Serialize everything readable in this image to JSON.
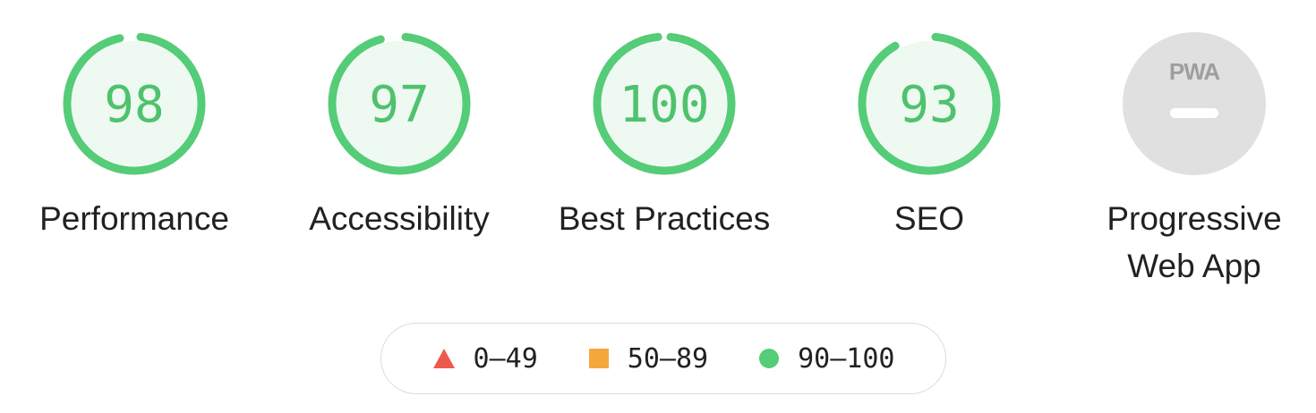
{
  "colors": {
    "pass": "#55cc77",
    "pass_fill": "#eef9f1",
    "pass_text": "#4fc26d",
    "average": "#f4a83c",
    "fail": "#ec5a4b",
    "na_fill": "#e0e0e0",
    "na_mark": "#9e9e9e",
    "text": "#212121"
  },
  "categories": [
    {
      "id": "performance",
      "score": 98,
      "label": "Performance"
    },
    {
      "id": "accessibility",
      "score": 97,
      "label": "Accessibility"
    },
    {
      "id": "best-practices",
      "score": 100,
      "label": "Best Practices"
    },
    {
      "id": "seo",
      "score": 93,
      "label": "SEO"
    }
  ],
  "pwa": {
    "badge_text": "PWA",
    "label_line1": "Progressive",
    "label_line2": "Web App"
  },
  "legend": [
    {
      "shape": "triangle-icon",
      "range": "0–49"
    },
    {
      "shape": "square-icon",
      "range": "50–89"
    },
    {
      "shape": "circle-icon",
      "range": "90–100"
    }
  ]
}
